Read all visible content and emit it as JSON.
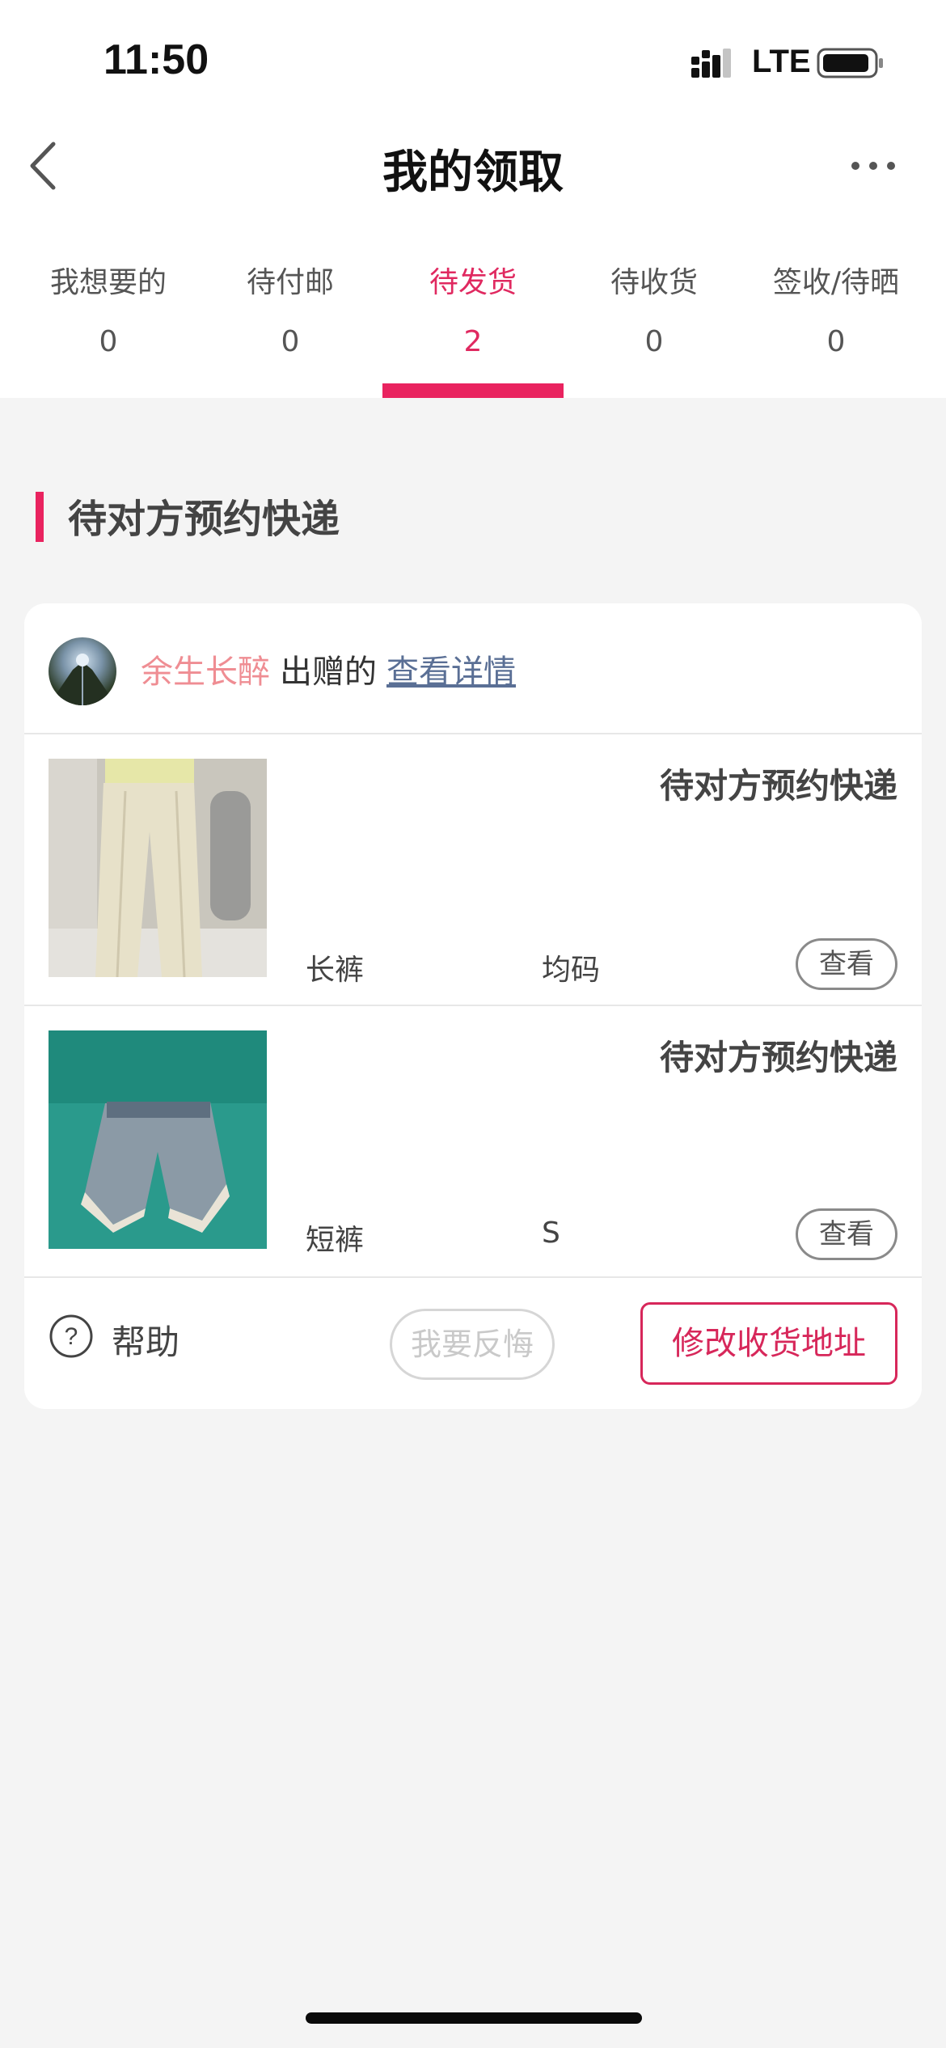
{
  "status_bar": {
    "time": "11:50",
    "network": "LTE"
  },
  "nav": {
    "title": "我的领取",
    "back_icon": "chevron-left-icon",
    "more_icon": "more-horizontal-icon"
  },
  "tabs": [
    {
      "label": "我想要的",
      "count": "0",
      "active": false
    },
    {
      "label": "待付邮",
      "count": "0",
      "active": false
    },
    {
      "label": "待发货",
      "count": "2",
      "active": true
    },
    {
      "label": "待收货",
      "count": "0",
      "active": false
    },
    {
      "label": "签收/待晒",
      "count": "0",
      "active": false
    }
  ],
  "section": {
    "title": "待对方预约快递"
  },
  "order": {
    "donor_name": "余生长醉",
    "donor_suffix": "出赠的",
    "detail_link": "查看详情",
    "items": [
      {
        "status": "待对方预约快递",
        "name": "长裤",
        "size": "均码",
        "view_label": "查看",
        "image": "beige-trousers"
      },
      {
        "status": "待对方预约快递",
        "name": "短裤",
        "size": "S",
        "view_label": "查看",
        "image": "denim-shorts"
      }
    ],
    "help_label": "帮助",
    "regret_label": "我要反悔",
    "address_label": "修改收货地址"
  },
  "colors": {
    "accent": "#e9235f",
    "donor_name": "#ef8d93",
    "link": "#5a6f95",
    "background": "#f4f4f4"
  }
}
